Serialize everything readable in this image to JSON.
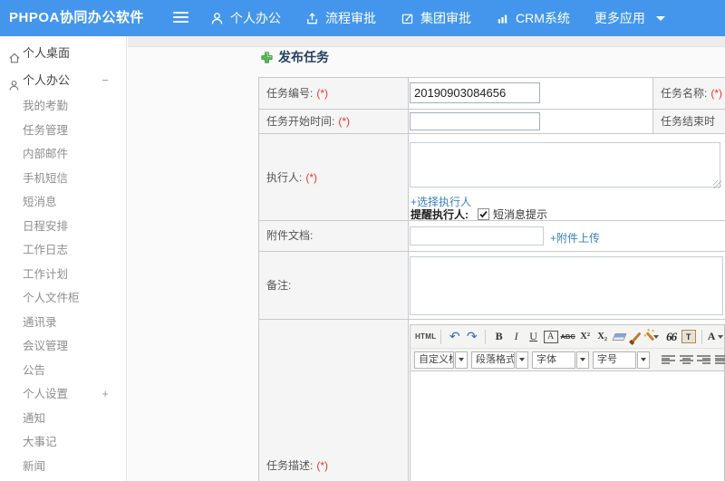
{
  "colors": {
    "topbar_bg": "#4496ec",
    "link_blue": "#3a7fc1",
    "required_red": "#ee3333",
    "title_navy": "#24405e",
    "accent_green": "#55b055"
  },
  "topbar": {
    "logo": "PHPOA协同办公软件",
    "nav": [
      {
        "id": "personal-office",
        "icon": "user-icon",
        "label": "个人办公"
      },
      {
        "id": "workflow-approval",
        "icon": "upload-icon",
        "label": "流程审批"
      },
      {
        "id": "group-approval",
        "icon": "edit-icon",
        "label": "集团审批"
      },
      {
        "id": "crm-system",
        "icon": "bar-chart-icon",
        "label": "CRM系统"
      },
      {
        "id": "more-apps",
        "icon": "caret-down-icon",
        "label": "更多应用",
        "caret": true
      }
    ]
  },
  "sidebar": {
    "items": [
      {
        "label": "个人桌面",
        "level": "parent",
        "icon": "home-icon"
      },
      {
        "label": "个人办公",
        "level": "parent",
        "icon": "user-icon",
        "toggle": "−"
      },
      {
        "label": "我的考勤",
        "level": "child"
      },
      {
        "label": "任务管理",
        "level": "child"
      },
      {
        "label": "内部邮件",
        "level": "child"
      },
      {
        "label": "手机短信",
        "level": "child"
      },
      {
        "label": "短消息",
        "level": "child"
      },
      {
        "label": "日程安排",
        "level": "child"
      },
      {
        "label": "工作日志",
        "level": "child"
      },
      {
        "label": "工作计划",
        "level": "child"
      },
      {
        "label": "个人文件柜",
        "level": "child"
      },
      {
        "label": "通讯录",
        "level": "child"
      },
      {
        "label": "会议管理",
        "level": "child"
      },
      {
        "label": "公告",
        "level": "child"
      },
      {
        "label": "个人设置",
        "level": "child",
        "toggle": "+"
      },
      {
        "label": "通知",
        "level": "child"
      },
      {
        "label": "大事记",
        "level": "child"
      },
      {
        "label": "新闻",
        "level": "child"
      }
    ]
  },
  "page": {
    "title": "发布任务"
  },
  "form": {
    "required_mark": "(*)",
    "fields": {
      "task_no": {
        "label": "任务编号:",
        "value": "20190903084656",
        "required": true
      },
      "task_name": {
        "label": "任务名称:",
        "required": true
      },
      "start_time": {
        "label": "任务开始时间:",
        "required": true
      },
      "end_time": {
        "label": "任务结束时间:",
        "required": true
      },
      "executor": {
        "label": "执行人:",
        "required": true,
        "select_link": "+选择执行人",
        "remind_label": "提醒执行人:",
        "sms_option": "短消息提示",
        "sms_checked": true
      },
      "attachment": {
        "label": "附件文档:",
        "upload_link": "+附件上传"
      },
      "remark": {
        "label": "备注:"
      },
      "description": {
        "label": "任务描述:",
        "required": true
      }
    }
  },
  "editor": {
    "toolbar_buttons": [
      {
        "name": "html-source-button",
        "glyph": "HTML",
        "cls": "tb-html"
      },
      {
        "name": "separator"
      },
      {
        "name": "undo-button",
        "glyph": "↶",
        "cls": "tb-undo"
      },
      {
        "name": "redo-button",
        "glyph": "↷",
        "cls": "tb-redo"
      },
      {
        "name": "separator"
      },
      {
        "name": "bold-button",
        "glyph": "B",
        "cls": "tb-bold"
      },
      {
        "name": "italic-button",
        "glyph": "I",
        "cls": "tb-italic"
      },
      {
        "name": "underline-button",
        "glyph": "U",
        "cls": "tb-underline"
      },
      {
        "name": "font-box-button",
        "glyph": "A",
        "cls": "tb-fontbox"
      },
      {
        "name": "strikethrough-button",
        "glyph": "ABC",
        "cls": "tb-strike"
      },
      {
        "name": "superscript-button",
        "glyph": "X²",
        "cls": "tb-sup"
      },
      {
        "name": "subscript-button",
        "glyph": "X₂",
        "cls": "tb-sub"
      },
      {
        "name": "eraser-button",
        "shape": "shape-eraser"
      },
      {
        "name": "format-brush-button",
        "shape": "shape-brush"
      },
      {
        "name": "auto-typeset-button",
        "shape": "shape-wand",
        "caret": true
      },
      {
        "name": "blockquote-button",
        "glyph": "66",
        "cls": "tb-quote"
      },
      {
        "name": "paste-plain-button",
        "glyph": "T",
        "cls": "tb-paste"
      },
      {
        "name": "separator"
      },
      {
        "name": "font-color-button",
        "glyph": "A",
        "cls": "tb-fontcolor",
        "caret": true
      }
    ],
    "dropdowns": [
      {
        "name": "custom-title-select",
        "label": "自定义标题"
      },
      {
        "name": "paragraph-format-select",
        "label": "段落格式"
      },
      {
        "name": "font-family-select",
        "label": "字体"
      },
      {
        "name": "font-size-select",
        "label": "字号"
      }
    ],
    "align_buttons": [
      "align-left-button",
      "align-center-button",
      "align-right-button",
      "align-justify-button"
    ]
  }
}
